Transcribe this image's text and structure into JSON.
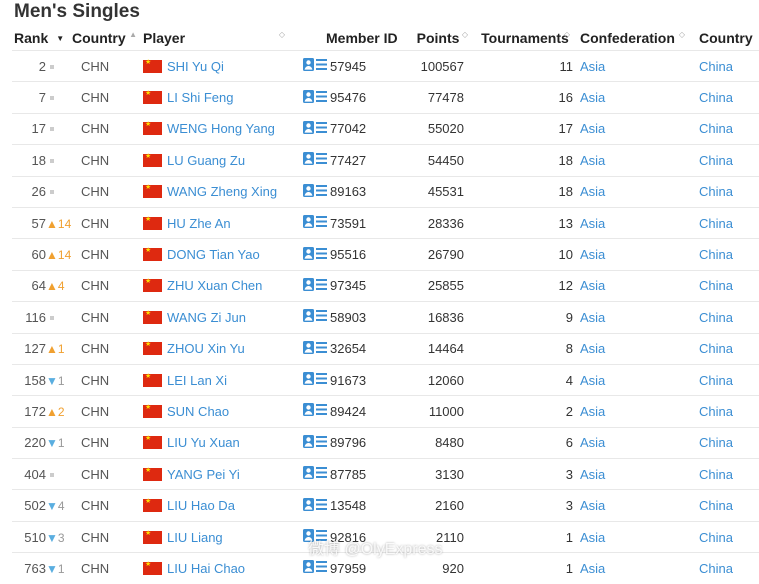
{
  "page_title": "Men's Singles",
  "columns": {
    "rank": "Rank",
    "country": "Country",
    "player": "Player",
    "member_id": "Member ID",
    "points": "Points",
    "tournaments": "Tournaments",
    "confederation": "Confederation",
    "country2": "Country"
  },
  "accent_color": "#3b8ed3",
  "up_color": "#f0a030",
  "down_color": "#5aaee0",
  "rows": [
    {
      "rank": "2",
      "move_dir": "none",
      "move": "",
      "country_code": "CHN",
      "player": "SHI Yu Qi",
      "member_id": "57945",
      "points": "100567",
      "tournaments": "11",
      "confederation": "Asia",
      "country": "China"
    },
    {
      "rank": "7",
      "move_dir": "none",
      "move": "",
      "country_code": "CHN",
      "player": "LI Shi Feng",
      "member_id": "95476",
      "points": "77478",
      "tournaments": "16",
      "confederation": "Asia",
      "country": "China"
    },
    {
      "rank": "17",
      "move_dir": "none",
      "move": "",
      "country_code": "CHN",
      "player": "WENG Hong Yang",
      "member_id": "77042",
      "points": "55020",
      "tournaments": "17",
      "confederation": "Asia",
      "country": "China"
    },
    {
      "rank": "18",
      "move_dir": "none",
      "move": "",
      "country_code": "CHN",
      "player": "LU Guang Zu",
      "member_id": "77427",
      "points": "54450",
      "tournaments": "18",
      "confederation": "Asia",
      "country": "China"
    },
    {
      "rank": "26",
      "move_dir": "none",
      "move": "",
      "country_code": "CHN",
      "player": "WANG Zheng Xing",
      "member_id": "89163",
      "points": "45531",
      "tournaments": "18",
      "confederation": "Asia",
      "country": "China"
    },
    {
      "rank": "57",
      "move_dir": "up",
      "move": "14",
      "country_code": "CHN",
      "player": "HU Zhe An",
      "member_id": "73591",
      "points": "28336",
      "tournaments": "13",
      "confederation": "Asia",
      "country": "China"
    },
    {
      "rank": "60",
      "move_dir": "up",
      "move": "14",
      "country_code": "CHN",
      "player": "DONG Tian Yao",
      "member_id": "95516",
      "points": "26790",
      "tournaments": "10",
      "confederation": "Asia",
      "country": "China"
    },
    {
      "rank": "64",
      "move_dir": "up",
      "move": "4",
      "country_code": "CHN",
      "player": "ZHU Xuan Chen",
      "member_id": "97345",
      "points": "25855",
      "tournaments": "12",
      "confederation": "Asia",
      "country": "China"
    },
    {
      "rank": "116",
      "move_dir": "none",
      "move": "",
      "country_code": "CHN",
      "player": "WANG Zi Jun",
      "member_id": "58903",
      "points": "16836",
      "tournaments": "9",
      "confederation": "Asia",
      "country": "China"
    },
    {
      "rank": "127",
      "move_dir": "up",
      "move": "1",
      "country_code": "CHN",
      "player": "ZHOU Xin Yu",
      "member_id": "32654",
      "points": "14464",
      "tournaments": "8",
      "confederation": "Asia",
      "country": "China"
    },
    {
      "rank": "158",
      "move_dir": "down",
      "move": "1",
      "country_code": "CHN",
      "player": "LEI Lan Xi",
      "member_id": "91673",
      "points": "12060",
      "tournaments": "4",
      "confederation": "Asia",
      "country": "China"
    },
    {
      "rank": "172",
      "move_dir": "up",
      "move": "2",
      "country_code": "CHN",
      "player": "SUN Chao",
      "member_id": "89424",
      "points": "11000",
      "tournaments": "2",
      "confederation": "Asia",
      "country": "China"
    },
    {
      "rank": "220",
      "move_dir": "down",
      "move": "1",
      "country_code": "CHN",
      "player": "LIU Yu Xuan",
      "member_id": "89796",
      "points": "8480",
      "tournaments": "6",
      "confederation": "Asia",
      "country": "China"
    },
    {
      "rank": "404",
      "move_dir": "none",
      "move": "",
      "country_code": "CHN",
      "player": "YANG Pei Yi",
      "member_id": "87785",
      "points": "3130",
      "tournaments": "3",
      "confederation": "Asia",
      "country": "China"
    },
    {
      "rank": "502",
      "move_dir": "down",
      "move": "4",
      "country_code": "CHN",
      "player": "LIU Hao Da",
      "member_id": "13548",
      "points": "2160",
      "tournaments": "3",
      "confederation": "Asia",
      "country": "China"
    },
    {
      "rank": "510",
      "move_dir": "down",
      "move": "3",
      "country_code": "CHN",
      "player": "LIU Liang",
      "member_id": "92816",
      "points": "2110",
      "tournaments": "1",
      "confederation": "Asia",
      "country": "China"
    },
    {
      "rank": "763",
      "move_dir": "down",
      "move": "1",
      "country_code": "CHN",
      "player": "LIU Hai Chao",
      "member_id": "97959",
      "points": "920",
      "tournaments": "1",
      "confederation": "Asia",
      "country": "China"
    }
  ],
  "watermark": "微博 @OlyExpress"
}
